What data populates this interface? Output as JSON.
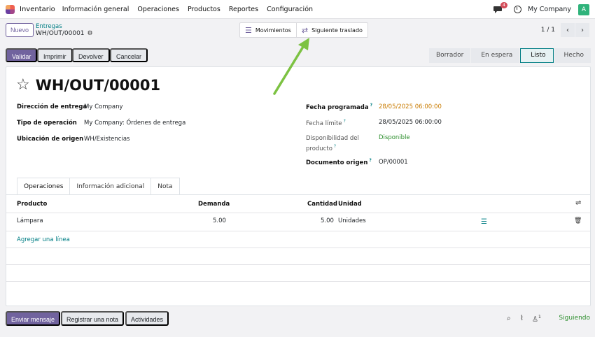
{
  "navbar": {
    "app_name": "Inventario",
    "menu": [
      "Información general",
      "Operaciones",
      "Productos",
      "Reportes",
      "Configuración"
    ],
    "chat_badge": "4",
    "company": "My Company",
    "avatar_letter": "A"
  },
  "control": {
    "new_button": "Nuevo",
    "breadcrumb_parent": "Entregas",
    "breadcrumb_current": "WH/OUT/00001",
    "smart_buttons": {
      "moves": "Movimientos",
      "next_transfer": "Siguiente traslado"
    },
    "pager": "1 / 1"
  },
  "actions": {
    "validate": "Validar",
    "print": "Imprimir",
    "return": "Devolver",
    "cancel": "Cancelar"
  },
  "stages": [
    "Borrador",
    "En espera",
    "Listo",
    "Hecho"
  ],
  "active_stage": "Listo",
  "record": {
    "title": "WH/OUT/00001",
    "delivery_address_label": "Dirección de entrega",
    "delivery_address": "My Company",
    "operation_type_label": "Tipo de operación",
    "operation_type": "My Company: Órdenes de entrega",
    "source_location_label": "Ubicación de origen",
    "source_location": "WH/Existencias",
    "scheduled_date_label": "Fecha programada",
    "scheduled_date": "28/05/2025 06:00:00",
    "deadline_label": "Fecha límite",
    "deadline": "28/05/2025 06:00:00",
    "availability_label_1": "Disponibilidad del",
    "availability_label_2": "producto",
    "availability": "Disponible",
    "origin_label": "Documento origen",
    "origin": "OP/00001",
    "help_mark": "?"
  },
  "tabs": [
    "Operaciones",
    "Información adicional",
    "Nota"
  ],
  "table": {
    "headers": {
      "product": "Producto",
      "demand": "Demanda",
      "quantity": "Cantidad",
      "unit": "Unidad"
    },
    "rows": [
      {
        "product": "Lámpara",
        "demand": "5.00",
        "quantity": "5.00",
        "unit": "Unidades"
      }
    ],
    "add_line": "Agregar una línea"
  },
  "chatter": {
    "send_message": "Enviar mensaje",
    "log_note": "Registrar una nota",
    "activities": "Actividades",
    "followers_count": "1",
    "following": "Siguiendo"
  },
  "colors": {
    "primary": "#71639e",
    "link": "#017e84",
    "annotation_arrow": "#7cc242"
  }
}
